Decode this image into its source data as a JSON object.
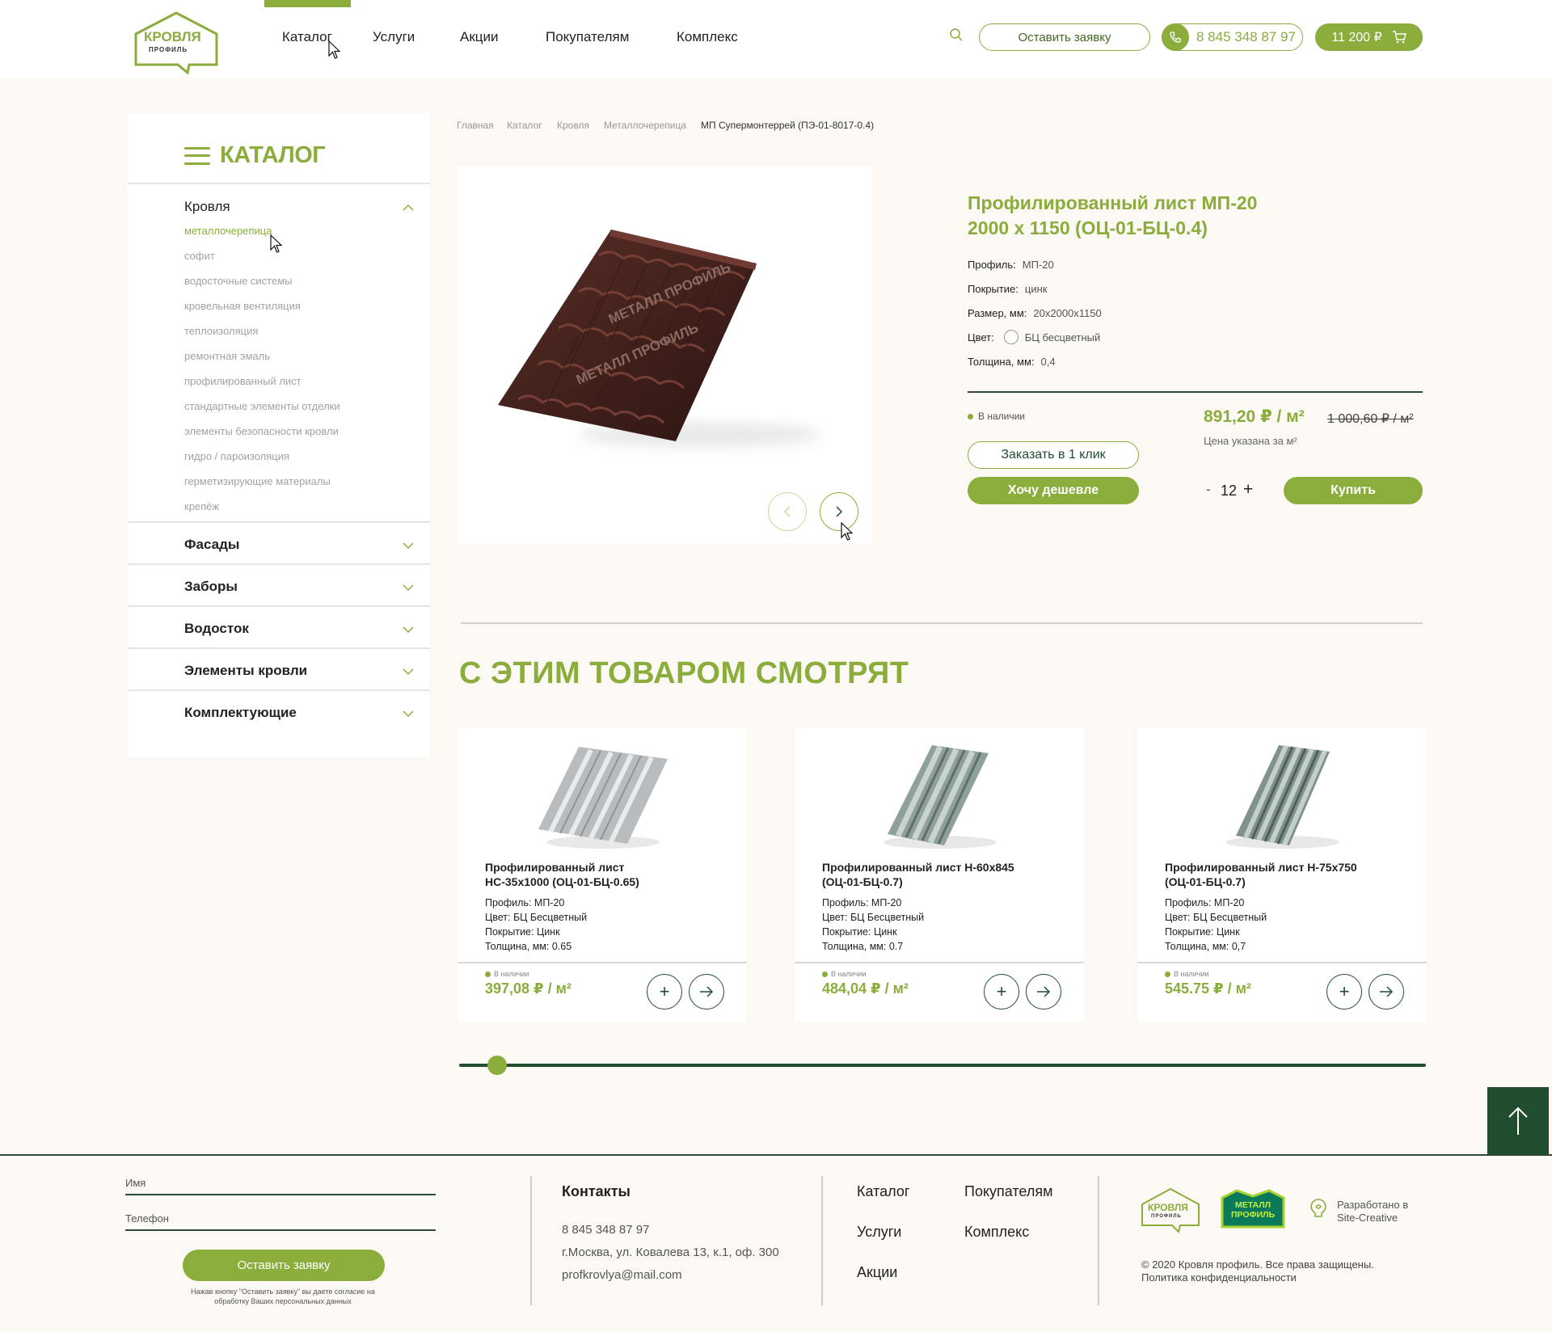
{
  "header": {
    "logo_title": "КРОВЛЯ",
    "logo_subtitle": "ПРОФИЛЬ",
    "nav": [
      "Каталог",
      "Услуги",
      "Акции",
      "Покупателям",
      "Комплекс"
    ],
    "request_button": "Оставить заявку",
    "phone": "8 845 348 87 97",
    "cart_total": "11 200 ₽"
  },
  "sidebar": {
    "title": "КАТАЛОГ",
    "groups": [
      {
        "label": "Кровля",
        "expanded": true,
        "items": [
          "металлочерепица",
          "софит",
          "водосточные системы",
          "кровельная вентиляция",
          "теплоизоляция",
          "ремонтная эмаль",
          "профилированный лист",
          "стандартные элементы отделки",
          "элементы безопасности кровли",
          "гидро / пароизоляция",
          "герметизирующие материалы",
          "крепёж"
        ]
      },
      {
        "label": "Фасады"
      },
      {
        "label": "Заборы"
      },
      {
        "label": "Водосток"
      },
      {
        "label": "Элементы кровли"
      },
      {
        "label": "Комплектующие"
      }
    ]
  },
  "breadcrumb": [
    "Главная",
    "Каталог",
    "Кровля",
    "Металлочерепица",
    "МП Супермонтеррей (ПЭ-01-8017-0.4)"
  ],
  "product": {
    "title_line1": "Профилированный лист МП-20",
    "title_line2": "2000 х 1150 (ОЦ-01-БЦ-0.4)",
    "specs": [
      {
        "label": "Профиль:",
        "value": "МП-20"
      },
      {
        "label": "Покрытие:",
        "value": "цинк"
      },
      {
        "label": "Размер, мм:",
        "value": "20x2000x1150"
      },
      {
        "label": "Цвет:",
        "value": "БЦ бесцветный"
      },
      {
        "label": "Толщина, мм:",
        "value": "0,4"
      }
    ],
    "stock": "В наличии",
    "price": "891,20 ₽ / м²",
    "old_price": "1 000,60 ₽ / м²",
    "price_note": "Цена указана за м²",
    "one_click_button": "Заказать в 1 клик",
    "cheaper_button": "Хочу дешевле",
    "quantity_minus": "-",
    "quantity": "12",
    "quantity_plus": "+",
    "buy_button": "Купить",
    "watermark": "МЕТАЛЛ ПРОФИЛЬ"
  },
  "related": {
    "title": "С ЭТИМ ТОВАРОМ СМОТРЯТ",
    "slider_position": 0.03,
    "items": [
      {
        "title_line1": "Профилированный лист",
        "title_line2": "НС-35х1000 (ОЦ-01-БЦ-0.65)",
        "profile": "Профиль: МП-20",
        "color": "Цвет: БЦ Бесцветный",
        "coating": "Покрытие: Цинк",
        "thickness": "Толщина, мм: 0.65",
        "stock": "В наличии",
        "price": "397,08 ₽ / м²"
      },
      {
        "title_line1": "Профилированный лист Н-60х845",
        "title_line2": "(ОЦ-01-БЦ-0.7)",
        "profile": "Профиль: МП-20",
        "color": "Цвет: БЦ Бесцветный",
        "coating": "Покрытие: Цинк",
        "thickness": "Толщина, мм: 0.7",
        "stock": "В наличии",
        "price": "484,04 ₽ / м²"
      },
      {
        "title_line1": "Профилированный лист Н-75х750",
        "title_line2": "(ОЦ-01-БЦ-0.7)",
        "profile": "Профиль: МП-20",
        "color": "Цвет: БЦ Бесцветный",
        "coating": "Покрытие: Цинк",
        "thickness": "Толщина, мм: 0,7",
        "stock": "В наличии",
        "price": "545.75 ₽ / м²"
      }
    ]
  },
  "footer": {
    "name_placeholder": "Имя",
    "phone_placeholder": "Телефон",
    "submit_button": "Оставить заявку",
    "consent_line1": "Нажав кнопку \"Оставить заявку\" вы даете согласие на",
    "consent_line2": "обработку Ваших персональных данных",
    "contacts_title": "Контакты",
    "phone": "8 845 348 87 97",
    "address": "г.Москва, ул. Ковалева 13, к.1, оф. 300",
    "email": "profkrovlya@mail.com",
    "nav_col1": [
      "Каталог",
      "Услуги",
      "Акции"
    ],
    "nav_col2": [
      "Покупателям",
      "Комплекс"
    ],
    "partner_logo_line1": "МЕТАЛЛ",
    "partner_logo_line2": "ПРОФИЛЬ",
    "developer_line1": "Разработано в",
    "developer_line2": "Site-Creative",
    "copyright": "© 2020 Кровля профиль. Все права защищены.",
    "privacy": "Политика конфиденциальности"
  },
  "colors": {
    "accent": "#8aad3c",
    "dark": "#1f4d2e",
    "background": "#fcf8f3",
    "product_brown": "#4a2520"
  }
}
